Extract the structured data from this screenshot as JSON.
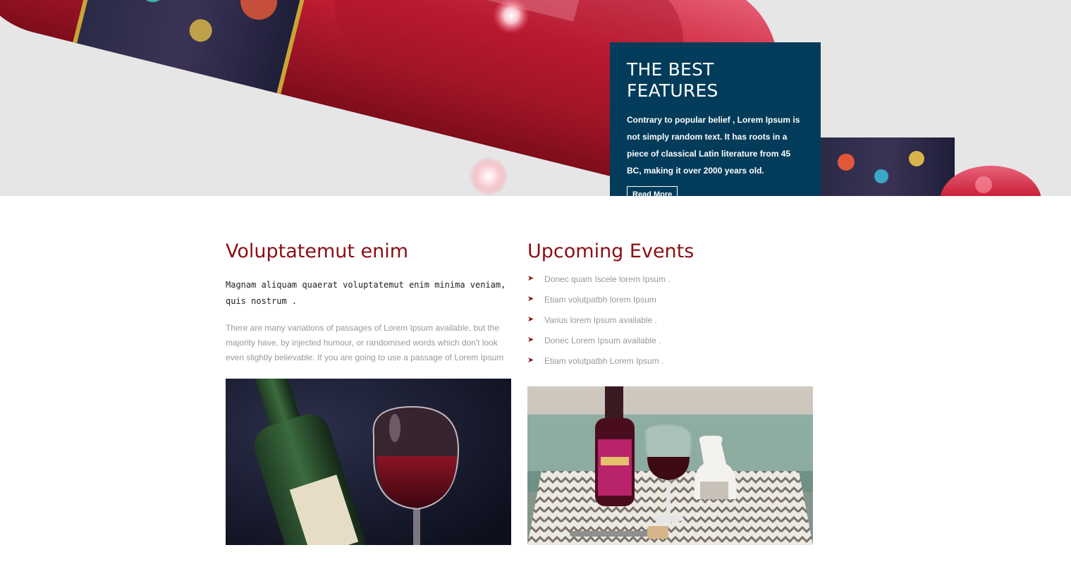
{
  "hero": {
    "title": "THE BEST FEATURES",
    "text": "Contrary to popular belief , Lorem Ipsum is not simply random text. It has roots in a piece of classical Latin literature from 45 BC, making it over 2000 years old.",
    "button_label": "Read More"
  },
  "left": {
    "heading": "Voluptatemut enim",
    "lead": "Magnam aliquam quaerat voluptatemut enim minima veniam, quis nostrum .",
    "body": "There are many variations of passages of Lorem Ipsum available, but the majority have, by injected humour, or randomised words which don't look even slightly believable. If you are going to use a passage of Lorem Ipsum"
  },
  "right": {
    "heading": "Upcoming Events",
    "events": [
      "Donec quam Iscele lorem Ipsum .",
      "Etiam volutpatbh lorem Ipsum",
      "Varius lorem Ipsum available .",
      "Donec Lorem Ipsum available .",
      "Etiam volutpatbh Lorem Ipsum ."
    ]
  },
  "icons": {
    "event_bullet": "arrow-right-icon"
  },
  "colors": {
    "feature_box": "#033c5a",
    "heading": "#8a0f14",
    "hero_bg": "#e6e6e6"
  }
}
